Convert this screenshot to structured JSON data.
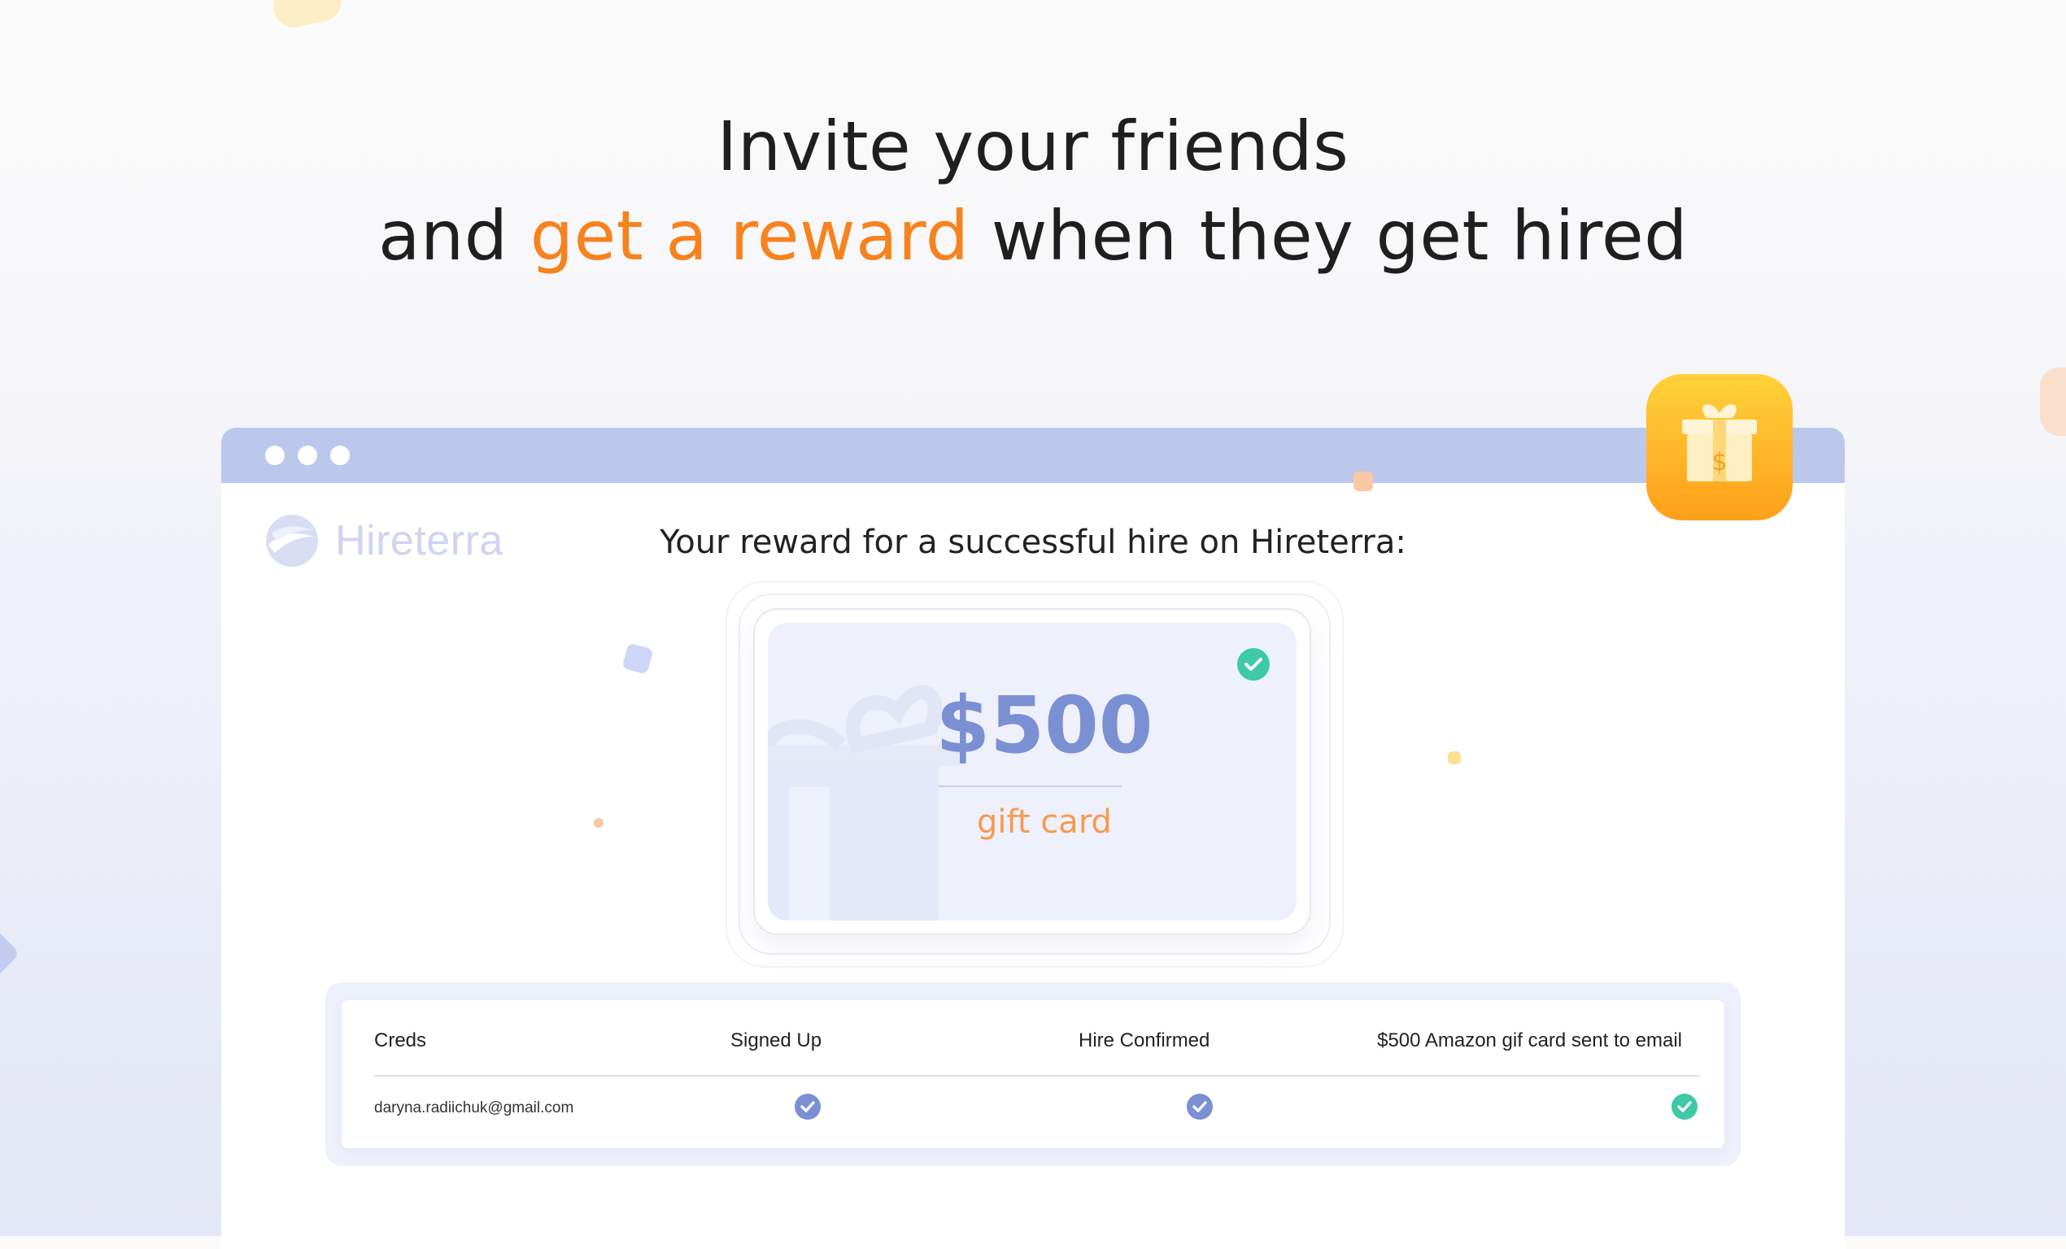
{
  "headline": {
    "line1": "Invite your friends",
    "line2_prefix": "and",
    "line2_accent": "get a reward",
    "line2_suffix": "when they get hired"
  },
  "app": {
    "logo_text": "Hireterra",
    "reward_title": "Your reward for a successful hire on Hireterra:"
  },
  "gift_card": {
    "amount": "$500",
    "label": "gift card",
    "gift_icon_symbol": "$"
  },
  "table": {
    "headers": {
      "creds": "Creds",
      "signed_up": "Signed Up",
      "hire_confirmed": "Hire Confirmed",
      "reward_sent": "$500 Amazon gif card sent to email"
    },
    "rows": [
      {
        "email": "daryna.radiichuk@gmail.com",
        "signed_up": true,
        "hire_confirmed": true,
        "reward_sent": true
      }
    ]
  },
  "colors": {
    "accent_orange": "#f7821e",
    "browser_bar": "#bcc7ec",
    "check_blue": "#7b8fd3",
    "check_green": "#3ec9a7"
  },
  "icons": [
    "gift-icon",
    "check-circle-icon",
    "hireterra-logo-icon"
  ]
}
